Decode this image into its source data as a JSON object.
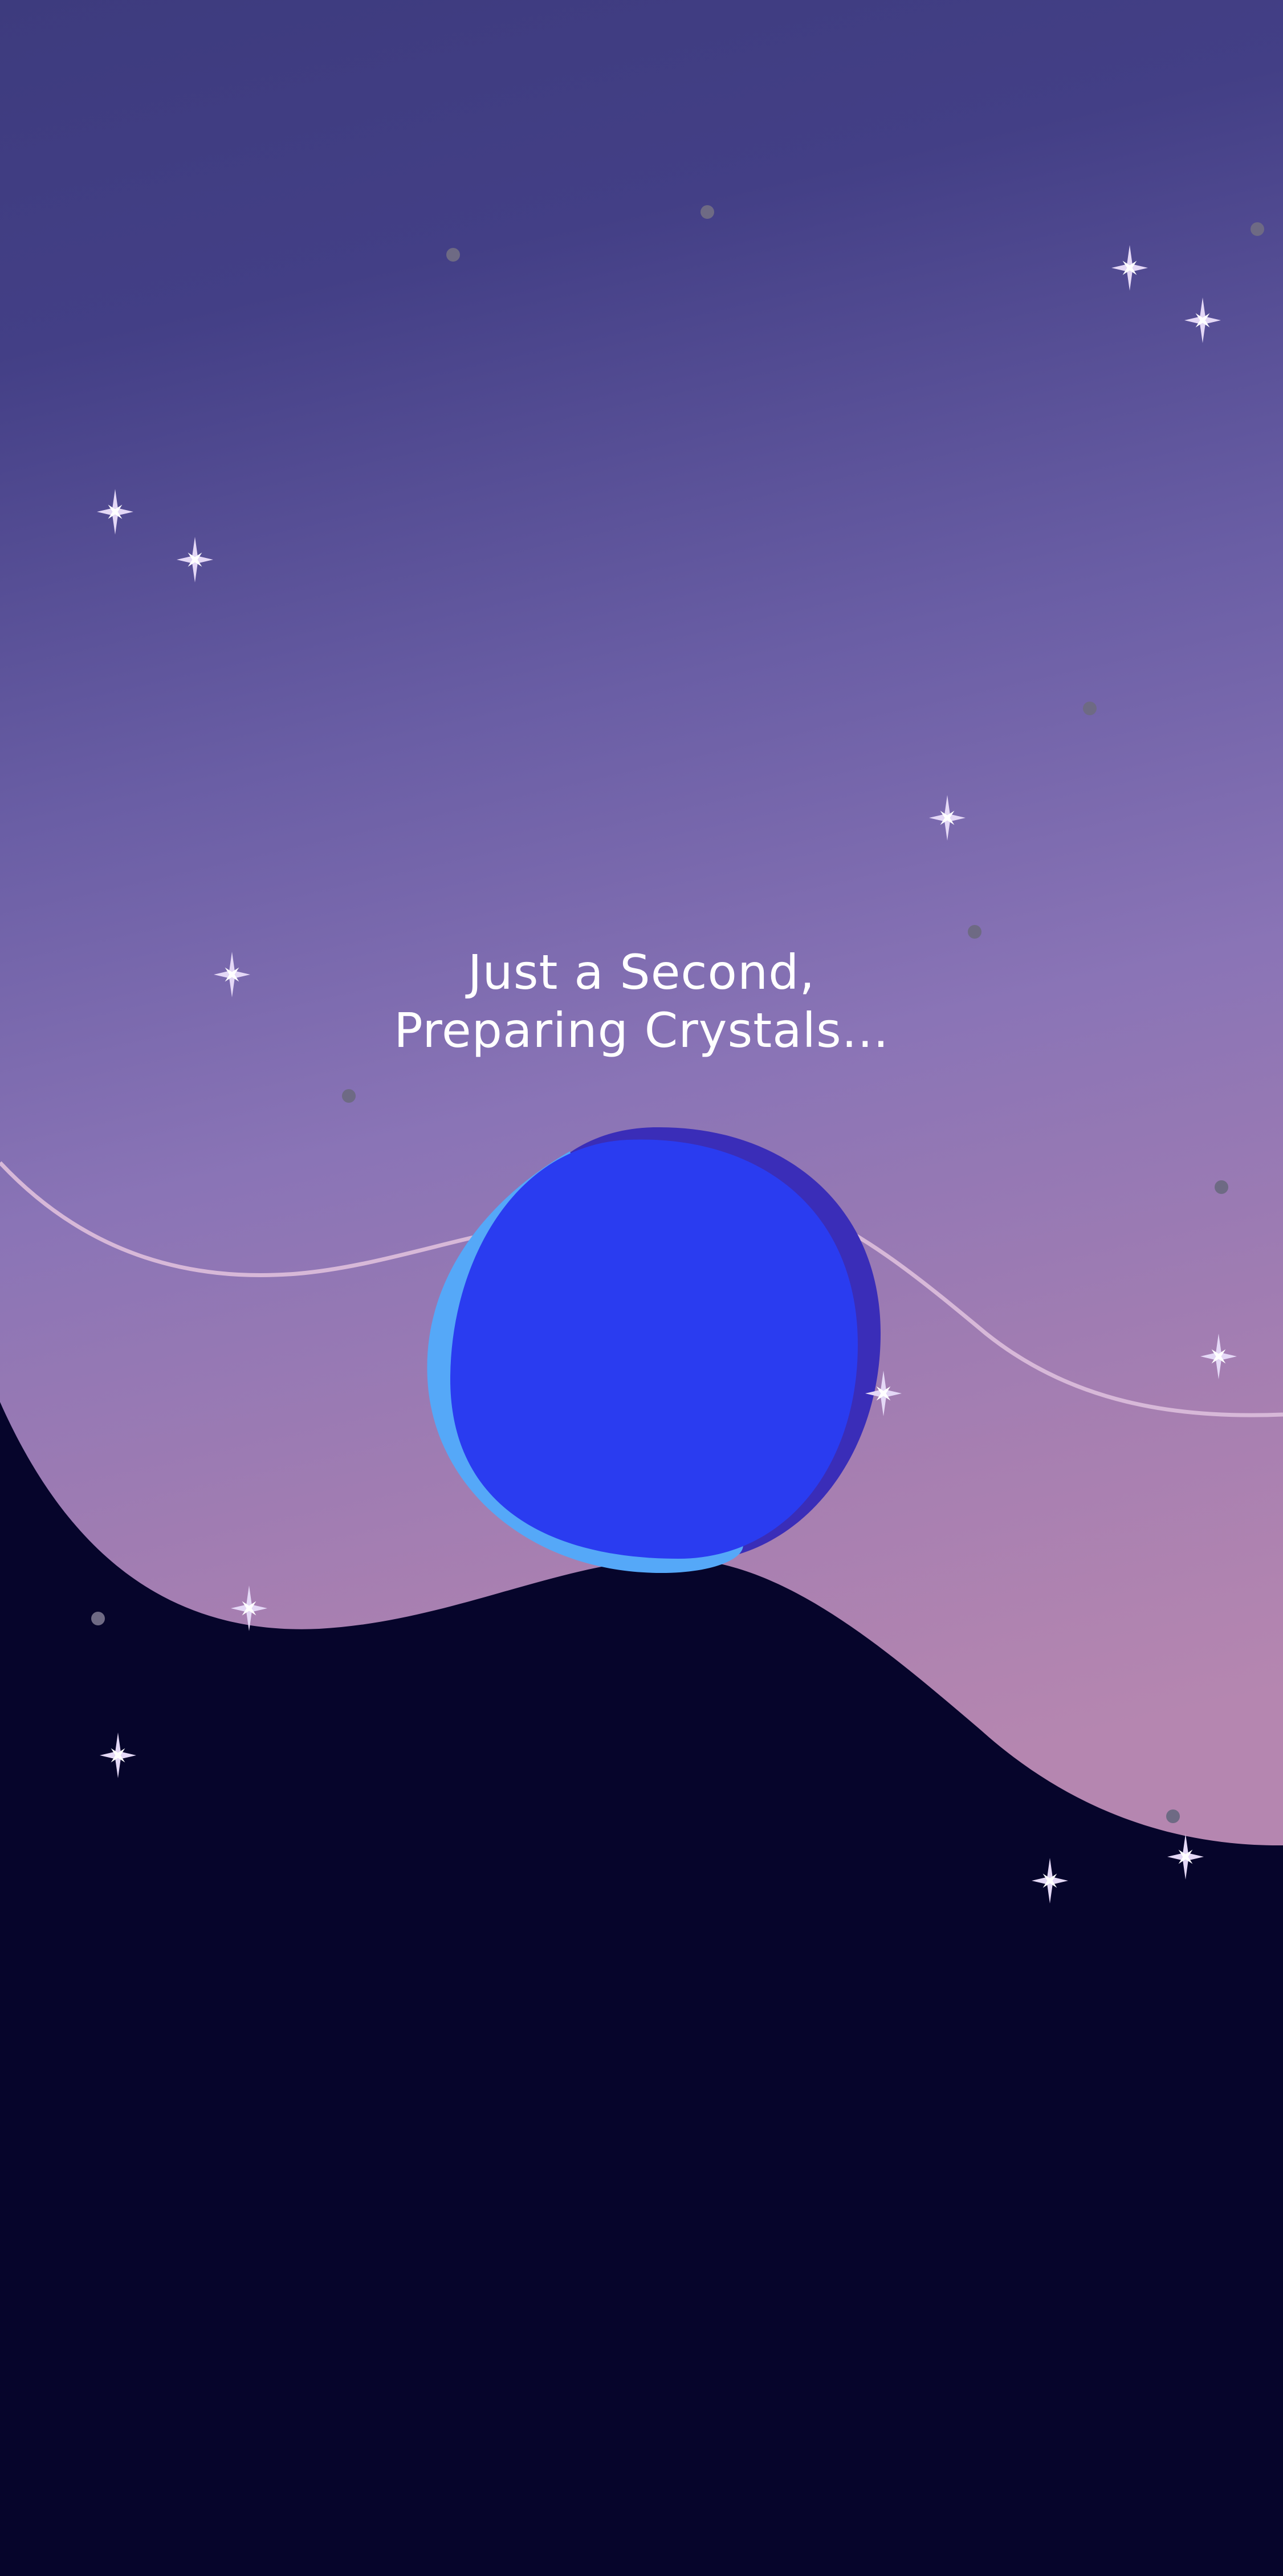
{
  "loading": {
    "line1": "Just a Second,",
    "line2": "Preparing Crystals..."
  },
  "colors": {
    "sky_top": "#3d3b7e",
    "sky_mid": "#8a74b6",
    "sky_horizon": "#a77fb1",
    "ground": "#06052b",
    "orb_main": "#2a3cf0",
    "orb_highlight": "#55a8f8",
    "orb_shadow": "#3a2db8",
    "orbit_line": "#d7b8d8",
    "sparkle": "#e4d8f6",
    "dot": "#6e6a84"
  },
  "icons": {
    "sparkle": "four-point-star",
    "dot": "small-circle"
  }
}
